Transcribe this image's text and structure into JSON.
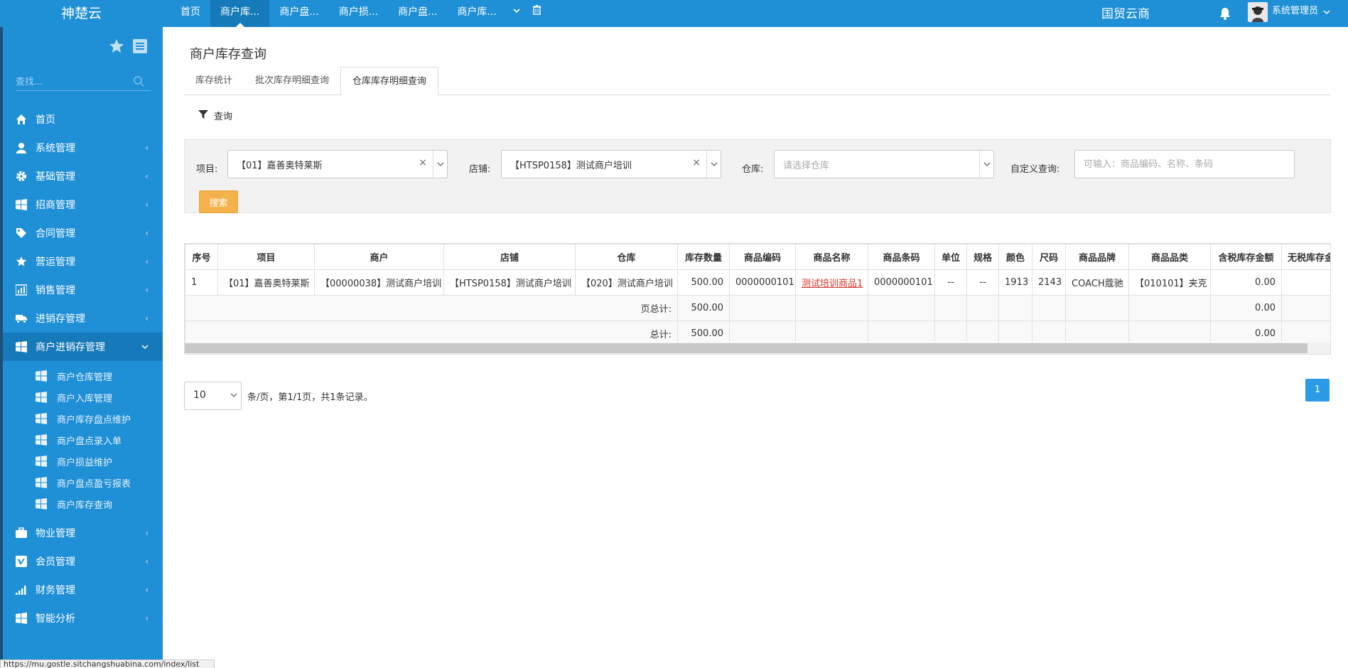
{
  "brand": "神楚云",
  "topnav": {
    "items": [
      {
        "label": "首页",
        "active": false
      },
      {
        "label": "商户库...",
        "active": true
      },
      {
        "label": "商户盘...",
        "active": false
      },
      {
        "label": "商户损...",
        "active": false
      },
      {
        "label": "商户盘...",
        "active": false
      },
      {
        "label": "商户库...",
        "active": false
      }
    ],
    "right_title": "国贸云商",
    "user_name": "系统管理员"
  },
  "sidebar": {
    "search_placeholder": "查找...",
    "menu": [
      {
        "label": "首页",
        "icon": "home-icon"
      },
      {
        "label": "系统管理",
        "icon": "user-icon"
      },
      {
        "label": "基础管理",
        "icon": "gear-icon"
      },
      {
        "label": "招商管理",
        "icon": "windows-icon"
      },
      {
        "label": "合同管理",
        "icon": "tag-icon"
      },
      {
        "label": "营运管理",
        "icon": "star-icon"
      },
      {
        "label": "销售管理",
        "icon": "bar-chart-icon"
      },
      {
        "label": "进销存管理",
        "icon": "truck-icon"
      },
      {
        "label": "商户进销存管理",
        "icon": "windows-icon"
      }
    ],
    "submenu": [
      {
        "label": "商户仓库管理"
      },
      {
        "label": "商户入库管理"
      },
      {
        "label": "商户库存盘点维护"
      },
      {
        "label": "商户盘点录入单"
      },
      {
        "label": "商户损益维护"
      },
      {
        "label": "商户盘点盈亏报表"
      },
      {
        "label": "商户库存查询"
      }
    ],
    "menu_after": [
      {
        "label": "物业管理",
        "icon": "briefcase-icon"
      },
      {
        "label": "会员管理",
        "icon": "vimeo-icon"
      },
      {
        "label": "财务管理",
        "icon": "signal-icon"
      },
      {
        "label": "智能分析",
        "icon": "windows-icon"
      }
    ]
  },
  "page": {
    "title": "商户库存查询",
    "tabs": [
      {
        "label": "库存统计",
        "active": false
      },
      {
        "label": "批次库存明细查询",
        "active": false
      },
      {
        "label": "仓库库存明细查询",
        "active": true
      }
    ],
    "query_label": "查询"
  },
  "filters": {
    "project_label": "项目:",
    "project_value": "【01】嘉善奥特莱斯",
    "store_label": "店铺:",
    "store_value": "【HTSP0158】测试商户培训",
    "warehouse_label": "仓库:",
    "warehouse_placeholder": "请选择仓库",
    "custom_label": "自定义查询:",
    "custom_placeholder": "可输入：商品编码、名称、条码",
    "search_button": "搜索"
  },
  "table": {
    "headers": [
      "序号",
      "项目",
      "商户",
      "店铺",
      "仓库",
      "库存数量",
      "商品编码",
      "商品名称",
      "商品条码",
      "单位",
      "规格",
      "颜色",
      "尺码",
      "商品品牌",
      "商品品类",
      "含税库存金额",
      "无税库存金"
    ],
    "rows": [
      [
        "1",
        "【01】嘉善奥特莱斯",
        "【00000038】测试商户培训",
        "【HTSP0158】测试商户培训",
        "【020】测试商户培训",
        "500.00",
        "0000000101",
        "测试培训商品1",
        "0000000101",
        "--",
        "--",
        "1913",
        "2143",
        "COACH蔻驰",
        "【010101】夹克",
        "0.00",
        ""
      ]
    ],
    "page_total_label": "页总计:",
    "page_total_qty": "500.00",
    "page_total_amount": "0.00",
    "grand_total_label": "总计:",
    "grand_total_qty": "500.00",
    "grand_total_amount": "0.00"
  },
  "pagination": {
    "page_size": "10",
    "info": "条/页，第1/1页，共1条记录。",
    "current_page": "1"
  },
  "statusbar": {
    "url": "https://mu.gostle.sitchangshuabina.com/index/list"
  }
}
